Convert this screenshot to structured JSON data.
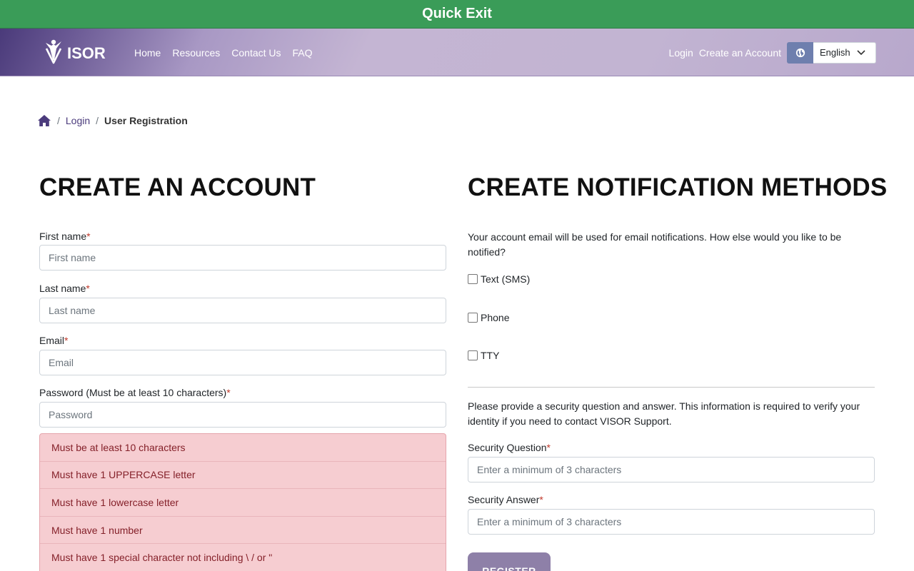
{
  "quick_exit": {
    "label": "Quick Exit"
  },
  "navbar": {
    "logo_text": "ISOR",
    "links": [
      "Home",
      "Resources",
      "Contact Us",
      "FAQ"
    ],
    "login": "Login",
    "create_account": "Create an Account",
    "language": {
      "selected": "English"
    }
  },
  "breadcrumb": {
    "items": [
      "Login",
      "User Registration"
    ]
  },
  "left": {
    "title": "CREATE AN ACCOUNT",
    "fields": [
      {
        "label": "First name",
        "required": "*",
        "placeholder": "First name"
      },
      {
        "label": "Last name",
        "required": "*",
        "placeholder": "Last name"
      },
      {
        "label": "Email",
        "required": "*",
        "placeholder": "Email"
      },
      {
        "label": "Password (Must be at least 10 characters)",
        "required": "*",
        "placeholder": "Password"
      }
    ],
    "password_rules": [
      "Must be at least 10 characters",
      "Must have 1 UPPERCASE letter",
      "Must have 1 lowercase letter",
      "Must have 1 number",
      "Must have 1 special character not including \\ / or \""
    ]
  },
  "right": {
    "title": "CREATE NOTIFICATION METHODS",
    "notification_notice": "Your account email will be used for email notifications. How else would you like to be notified?",
    "methods": [
      "Text (SMS)",
      "Phone",
      "TTY"
    ],
    "security_notice": "Please provide a security question and answer. This information is required to verify your identity if you need to contact VISOR Support.",
    "security_question": {
      "label": "Security Question",
      "required": "*",
      "placeholder": "Enter a minimum of 3 characters"
    },
    "security_answer": {
      "label": "Security Answer",
      "required": "*",
      "placeholder": "Enter a minimum of 3 characters"
    },
    "register_label": "REGISTER"
  },
  "colors": {
    "quick_exit_bg": "#3a9c58",
    "brand_purple": "#4b3b7c",
    "rule_bg": "#f6cdd1",
    "rule_text": "#842029"
  },
  "icons": [
    "visor-logo-icon",
    "globe-icon",
    "chevron-down-icon",
    "home-icon"
  ]
}
